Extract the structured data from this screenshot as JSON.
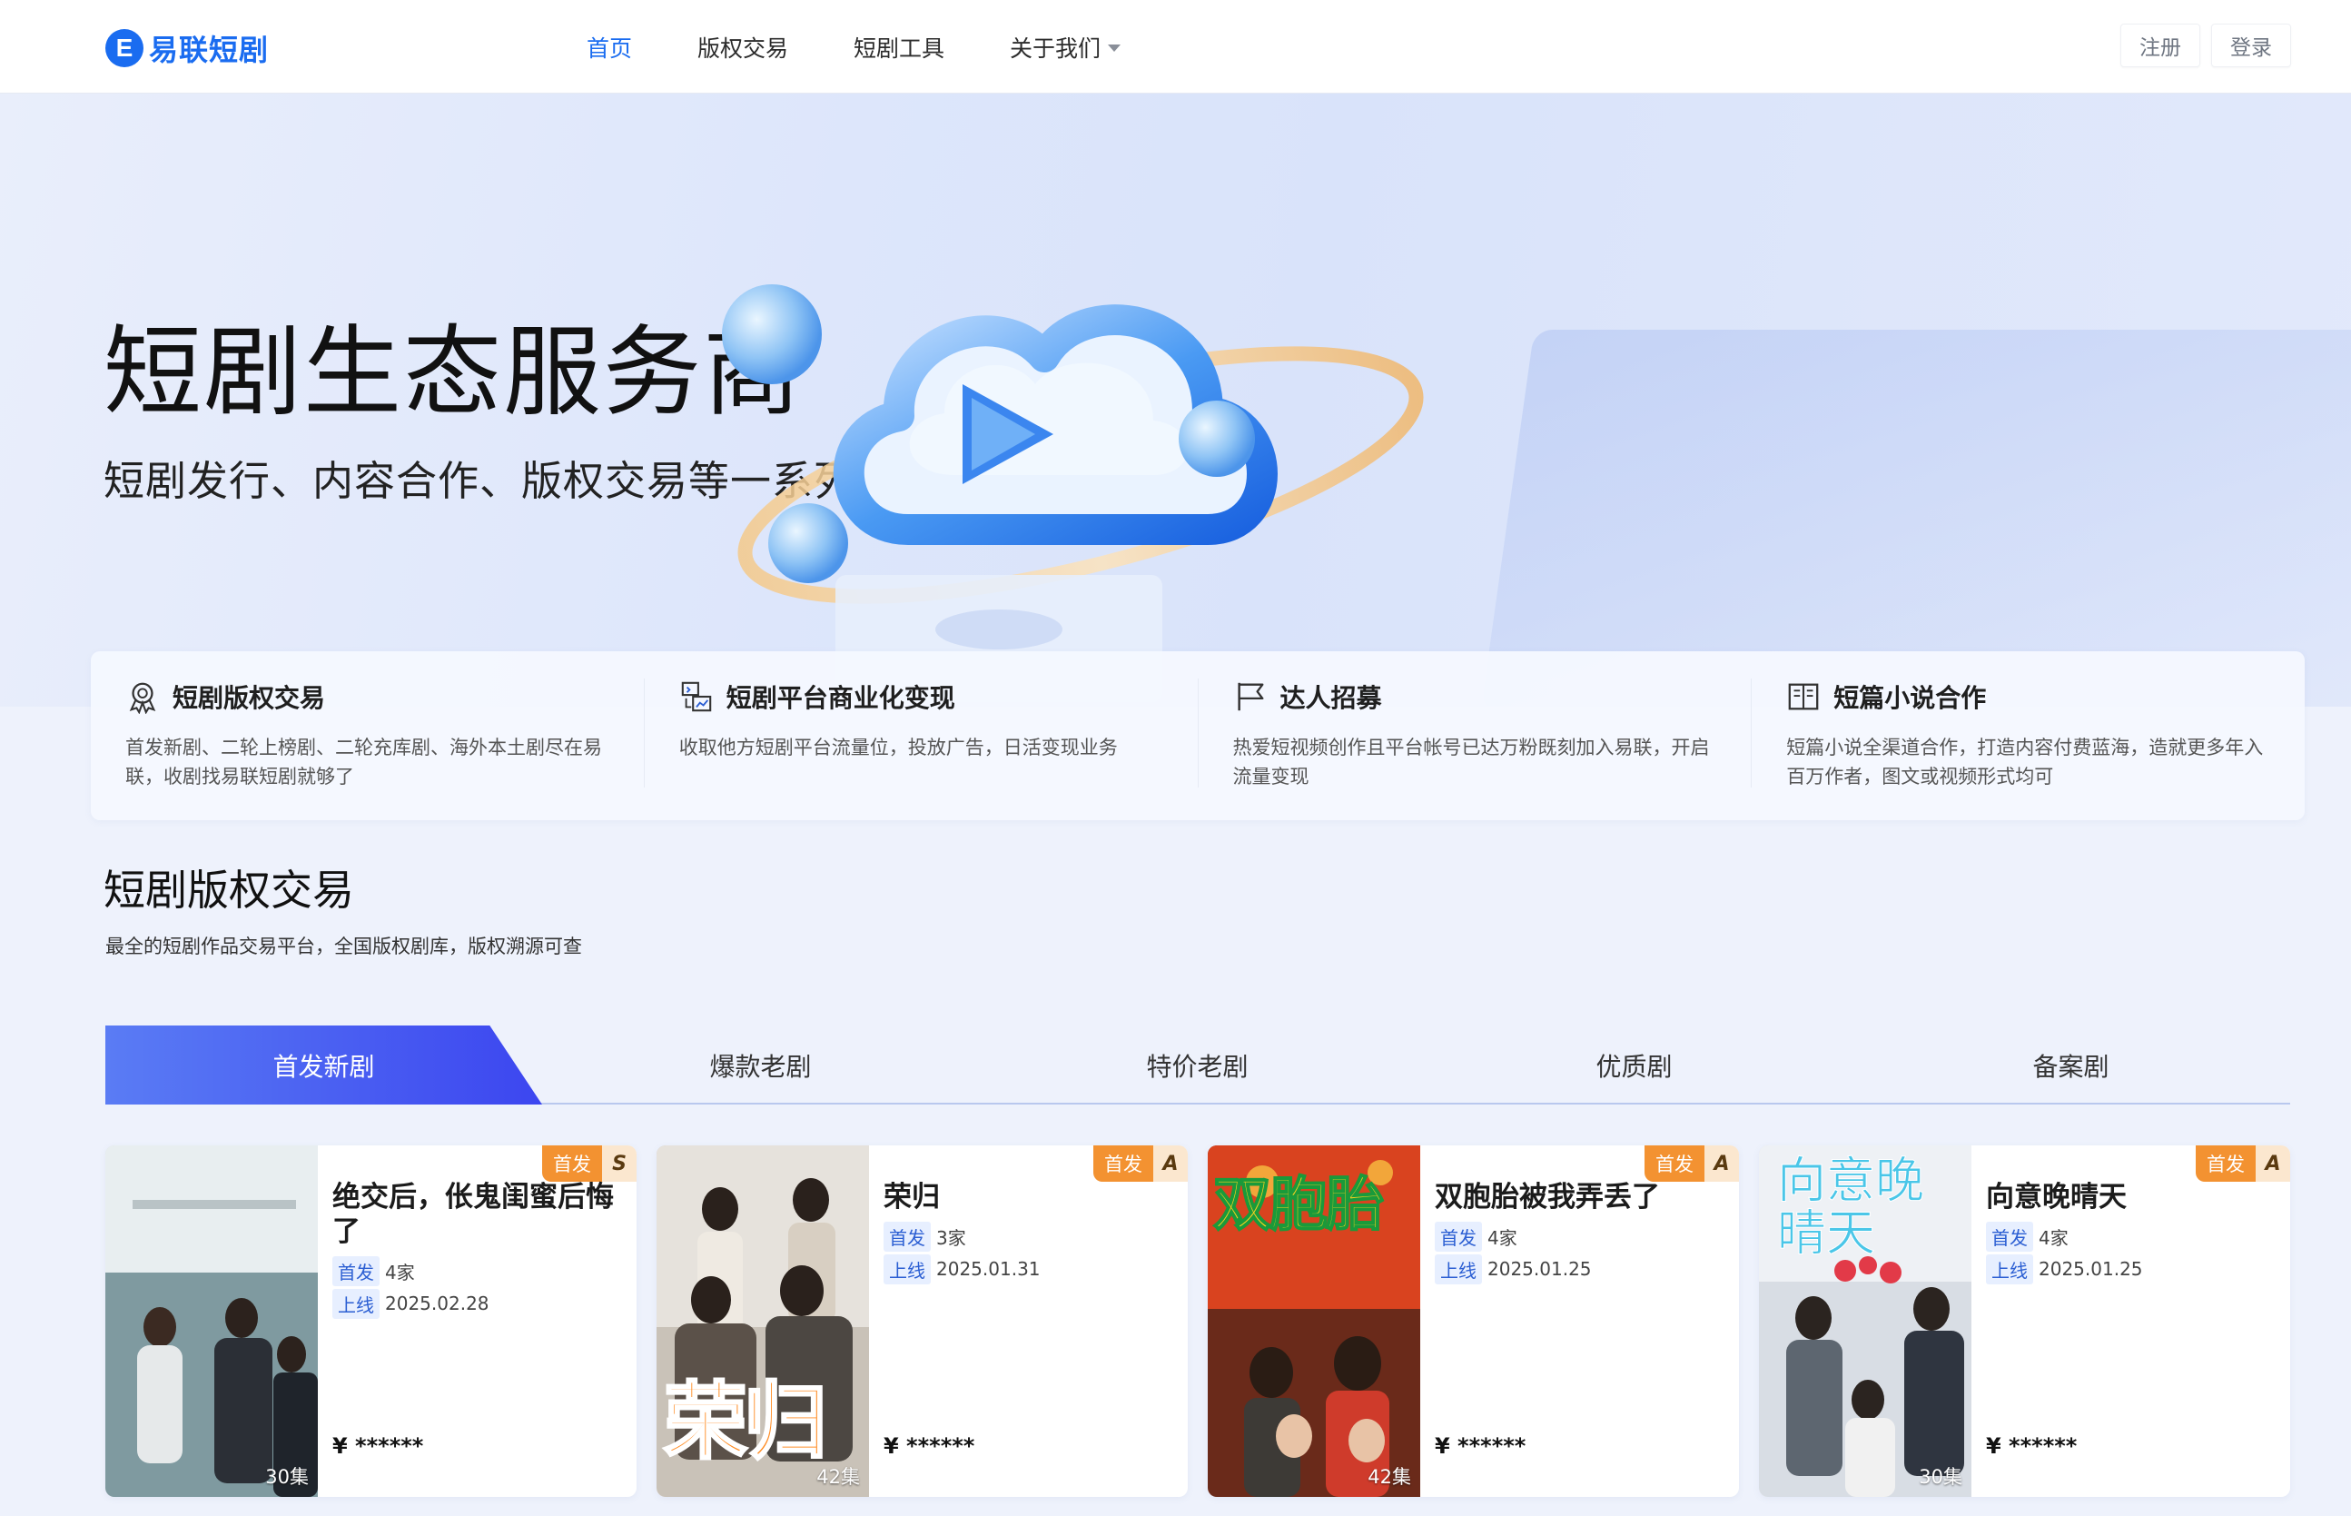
{
  "brand": {
    "name": "易联短剧",
    "mark": "E"
  },
  "nav": {
    "items": [
      {
        "label": "首页",
        "active": true
      },
      {
        "label": "版权交易",
        "active": false
      },
      {
        "label": "短剧工具",
        "active": false
      },
      {
        "label": "关于我们",
        "active": false,
        "dropdown": true
      }
    ],
    "register": "注册",
    "login": "登录"
  },
  "hero": {
    "title": "短剧生态服务商",
    "subtitle": "短剧发行、内容合作、版权交易等一系列产"
  },
  "services": [
    {
      "icon": "award-icon",
      "title": "短剧版权交易",
      "desc": "首发新剧、二轮上榜剧、二轮充库剧、海外本土剧尽在易联，收剧找易联短剧就够了"
    },
    {
      "icon": "chart-icon",
      "title": "短剧平台商业化变现",
      "desc": "收取他方短剧平台流量位，投放广告，日活变现业务"
    },
    {
      "icon": "flag-icon",
      "title": "达人招募",
      "desc": "热爱短视频创作且平台帐号已达万粉既刻加入易联，开启流量变现"
    },
    {
      "icon": "book-icon",
      "title": "短篇小说合作",
      "desc": "短篇小说全渠道合作，打造内容付费蓝海，造就更多年入百万作者，图文或视频形式均可"
    }
  ],
  "section": {
    "title": "短剧版权交易",
    "subtitle": "最全的短剧作品交易平台，全国版权剧库，版权溯源可查"
  },
  "tabs": [
    {
      "label": "首发新剧",
      "active": true
    },
    {
      "label": "爆款老剧",
      "active": false
    },
    {
      "label": "特价老剧",
      "active": false
    },
    {
      "label": "优质剧",
      "active": false
    },
    {
      "label": "备案剧",
      "active": false
    }
  ],
  "cards": [
    {
      "title": "绝交后，伥鬼闺蜜后悔了",
      "badge": "首发",
      "level": "S",
      "first_label": "首发",
      "first_value": "4家",
      "online_label": "上线",
      "online_value": "2025.02.28",
      "price": "¥ ******",
      "episodes": "30集",
      "poster_text": ""
    },
    {
      "title": "荣归",
      "badge": "首发",
      "level": "A",
      "first_label": "首发",
      "first_value": "3家",
      "online_label": "上线",
      "online_value": "2025.01.31",
      "price": "¥ ******",
      "episodes": "42集",
      "poster_text": "荣归"
    },
    {
      "title": "双胞胎被我弄丢了",
      "badge": "首发",
      "level": "A",
      "first_label": "首发",
      "first_value": "4家",
      "online_label": "上线",
      "online_value": "2025.01.25",
      "price": "¥ ******",
      "episodes": "42集",
      "poster_text": "双胞胎"
    },
    {
      "title": "向意晚晴天",
      "badge": "首发",
      "level": "A",
      "first_label": "首发",
      "first_value": "4家",
      "online_label": "上线",
      "online_value": "2025.01.25",
      "price": "¥ ******",
      "episodes": "30集",
      "poster_text": "向意晚晴天"
    }
  ],
  "colors": {
    "accent": "#1a6cf0",
    "badge": "#f39231",
    "tab_active_start": "#5a7cf4",
    "tab_active_end": "#3c46f0"
  }
}
